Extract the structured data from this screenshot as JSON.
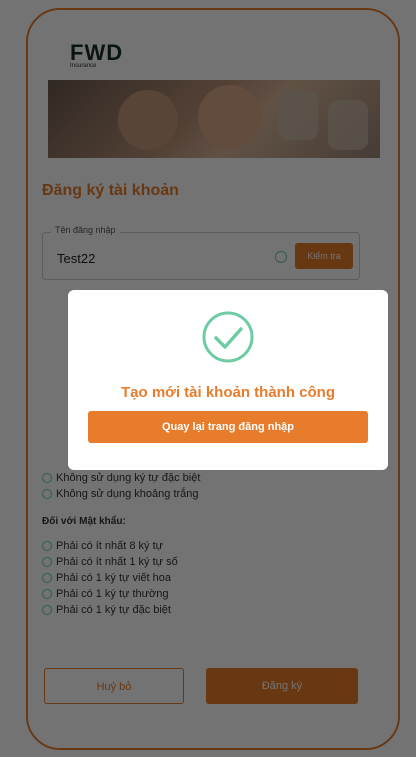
{
  "brand": {
    "logo": "FWD",
    "logo_sub": "Insurance",
    "accent": "#e77c2c",
    "success": "#6ecba3"
  },
  "form": {
    "title": "Đăng ký tài khoản",
    "username_label": "Tên đăng nhập",
    "username_value": "Test22",
    "check_button": "Kiểm tra"
  },
  "rules": {
    "username_items": [
      "Không sử dụng ký tự đặc biệt",
      "Không sử dụng khoảng trắng"
    ],
    "password_heading": "Đối với Mật khẩu:",
    "password_items": [
      "Phải có ít nhất 8 ký tự",
      "Phải có ít nhất 1 ký tự số",
      "Phải có 1 ký tự viết hoa",
      "Phải có 1 ký tự thường",
      "Phải có 1 ký tự đặc biệt"
    ]
  },
  "actions": {
    "cancel": "Huỷ bỏ",
    "register": "Đăng ký"
  },
  "modal": {
    "icon": "check-circle-icon",
    "message": "Tạo mới tài khoản thành công",
    "button": "Quay lại trang đăng nhập"
  }
}
